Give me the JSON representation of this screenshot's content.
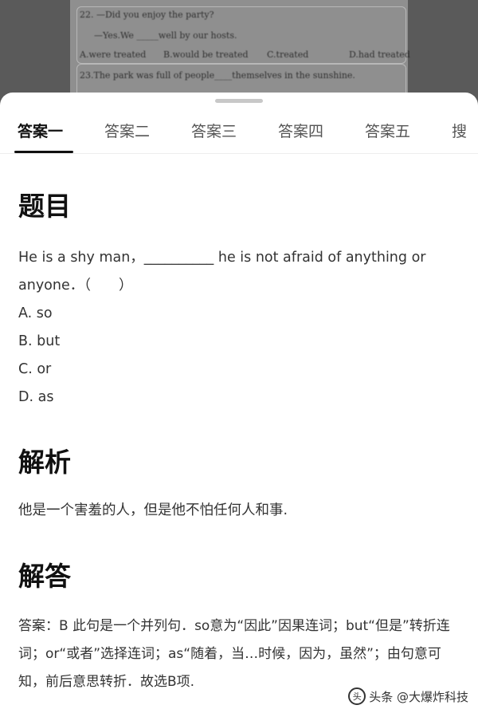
{
  "backdrop": {
    "line1": "22. —Did you enjoy the party?",
    "line2": "—Yes.We _____well by our hosts.",
    "options": [
      "A.were treated",
      "B.would be treated",
      "C.treated",
      "D.had treated"
    ],
    "line3": "23.The park was full of people____themselves in the sunshine."
  },
  "tabs": [
    "答案一",
    "答案二",
    "答案三",
    "答案四",
    "答案五",
    "搜"
  ],
  "question": {
    "title": "题目",
    "stem_line1": "He is a shy man，__________ he is not afraid of anything or",
    "stem_line2": "anyone．（　　）",
    "options": [
      "A. so",
      "B. but",
      "C. or",
      "D. as"
    ]
  },
  "analysis": {
    "title": "解析",
    "text": "他是一个害羞的人，但是他不怕任何人和事."
  },
  "answer": {
    "title": "解答",
    "text": "答案：B 此句是一个并列句．so意为“因此”因果连词；but“但是”转折连词；or“或者”选择连词；as“随着，当…时候，因为，虽然”；由句意可知，前后意思转折．故选B项."
  },
  "watermark": "头条 @大爆炸科技"
}
